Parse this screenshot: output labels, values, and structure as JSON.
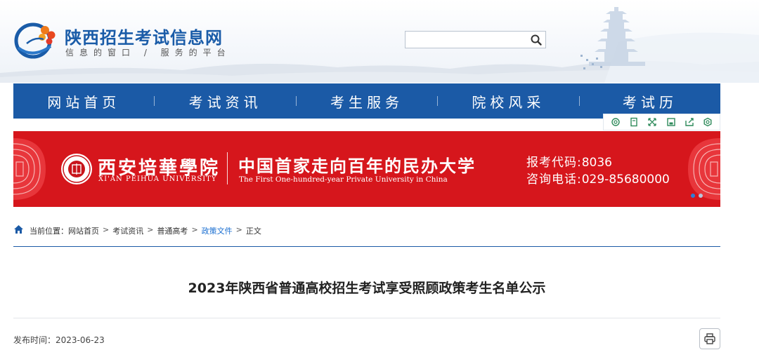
{
  "site": {
    "title": "陕西招生考试信息网",
    "slogan": "信息的窗口 / 服务的平台"
  },
  "search": {
    "placeholder": "",
    "value": ""
  },
  "nav": {
    "items": [
      {
        "label": "网站首页"
      },
      {
        "label": "考试资讯"
      },
      {
        "label": "考生服务"
      },
      {
        "label": "院校风采"
      },
      {
        "label": "考试历"
      }
    ]
  },
  "tools": [
    "refresh-icon",
    "bookmark-icon",
    "fullscreen-icon",
    "save-icon",
    "share-icon",
    "settings-icon"
  ],
  "banner": {
    "uni_name_cn": "西安培華學院",
    "uni_name_en": "XI'AN PEIHUA UNIVERSITY",
    "slogan_cn": "中国首家走向百年的民办大学",
    "slogan_en": "The First One-hundred-year Private University in China",
    "code_label": "报考代码:",
    "code_value": "8036",
    "phone_label": "咨询电话:",
    "phone_value": "029-85680000",
    "slide_count": 2,
    "active_slide": 0
  },
  "breadcrumb": {
    "prefix": "当前位置：",
    "items": [
      "网站首页",
      "考试资讯",
      "普通高考",
      "政策文件",
      "正文"
    ],
    "separator": ">",
    "active_index": 3
  },
  "article": {
    "title": "2023年陕西省普通高校招生考试享受照顾政策考生名单公示",
    "publish_label": "发布时间：",
    "publish_date": "2023-06-23"
  },
  "colors": {
    "nav_bg": "#1b5aa6",
    "banner_bg": "#d6161c",
    "title_blue": "#1a5ca8",
    "link_blue": "#1b6fd1"
  }
}
